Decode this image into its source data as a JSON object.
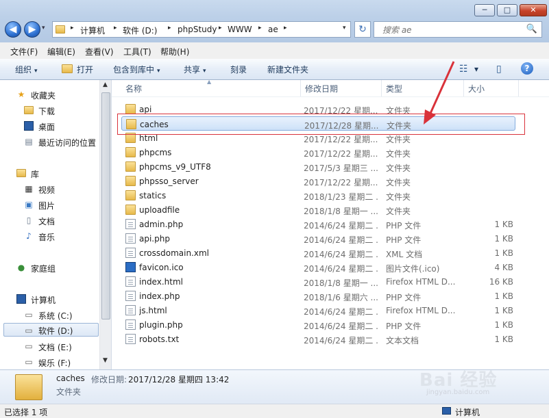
{
  "window": {
    "minimize": "─",
    "maximize": "□",
    "close": "✕"
  },
  "nav": {
    "back": "◀",
    "forward": "▶",
    "dropdown": "▾"
  },
  "address": {
    "crumbs": [
      "计算机",
      "软件 (D:)",
      "phpStudy",
      "WWW",
      "ae"
    ],
    "separator": "▸",
    "dropdown": "▾",
    "refresh": "↻"
  },
  "search": {
    "placeholder": "搜索 ae",
    "icon": "🔍"
  },
  "menu": [
    "文件(F)",
    "编辑(E)",
    "查看(V)",
    "工具(T)",
    "帮助(H)"
  ],
  "commands": {
    "organize": "组织",
    "open": "打开",
    "include": "包含到库中",
    "share": "共享",
    "burn": "刻录",
    "new_folder": "新建文件夹",
    "caret": "▾",
    "view_icon": "☷",
    "pane_icon": "▯",
    "help": "?"
  },
  "navpane": {
    "favorites": {
      "label": "收藏夹",
      "items": [
        "下载",
        "桌面",
        "最近访问的位置"
      ]
    },
    "libraries": {
      "label": "库",
      "items": [
        "视频",
        "图片",
        "文档",
        "音乐"
      ]
    },
    "homegroup": "家庭组",
    "computer": {
      "label": "计算机",
      "items": [
        "系统 (C:)",
        "软件 (D:)",
        "文档 (E:)",
        "娱乐 (F:)"
      ]
    },
    "scroll_up": "▲",
    "scroll_down": "▼"
  },
  "columns": {
    "name": "名称",
    "date": "修改日期",
    "type": "类型",
    "size": "大小",
    "sort_arrow": "▲"
  },
  "files": [
    {
      "name": "api",
      "date": "2017/12/22 星期...",
      "type": "文件夹",
      "size": "",
      "kind": "folder"
    },
    {
      "name": "caches",
      "date": "2017/12/28 星期...",
      "type": "文件夹",
      "size": "",
      "kind": "folder"
    },
    {
      "name": "html",
      "date": "2017/12/22 星期...",
      "type": "文件夹",
      "size": "",
      "kind": "folder"
    },
    {
      "name": "phpcms",
      "date": "2017/12/22 星期...",
      "type": "文件夹",
      "size": "",
      "kind": "folder"
    },
    {
      "name": "phpcms_v9_UTF8",
      "date": "2017/5/3 星期三 ...",
      "type": "文件夹",
      "size": "",
      "kind": "folder"
    },
    {
      "name": "phpsso_server",
      "date": "2017/12/22 星期...",
      "type": "文件夹",
      "size": "",
      "kind": "folder"
    },
    {
      "name": "statics",
      "date": "2018/1/23 星期二 ...",
      "type": "文件夹",
      "size": "",
      "kind": "folder"
    },
    {
      "name": "uploadfile",
      "date": "2018/1/8 星期一 ...",
      "type": "文件夹",
      "size": "",
      "kind": "folder"
    },
    {
      "name": "admin.php",
      "date": "2014/6/24 星期二 ...",
      "type": "PHP 文件",
      "size": "1 KB",
      "kind": "doc"
    },
    {
      "name": "api.php",
      "date": "2014/6/24 星期二 ...",
      "type": "PHP 文件",
      "size": "1 KB",
      "kind": "doc"
    },
    {
      "name": "crossdomain.xml",
      "date": "2014/6/24 星期二 ...",
      "type": "XML 文档",
      "size": "1 KB",
      "kind": "doc"
    },
    {
      "name": "favicon.ico",
      "date": "2014/6/24 星期二 ...",
      "type": "图片文件(.ico)",
      "size": "4 KB",
      "kind": "ico"
    },
    {
      "name": "index.html",
      "date": "2018/1/8 星期一 ...",
      "type": "Firefox HTML D...",
      "size": "16 KB",
      "kind": "doc"
    },
    {
      "name": "index.php",
      "date": "2018/1/6 星期六 ...",
      "type": "PHP 文件",
      "size": "1 KB",
      "kind": "doc"
    },
    {
      "name": "js.html",
      "date": "2014/6/24 星期二 ...",
      "type": "Firefox HTML D...",
      "size": "1 KB",
      "kind": "doc"
    },
    {
      "name": "plugin.php",
      "date": "2014/6/24 星期二 ...",
      "type": "PHP 文件",
      "size": "1 KB",
      "kind": "doc"
    },
    {
      "name": "robots.txt",
      "date": "2014/6/24 星期二 ...",
      "type": "文本文档",
      "size": "1 KB",
      "kind": "doc"
    }
  ],
  "selected_index": 1,
  "details": {
    "name": "caches",
    "modified_label": "修改日期:",
    "modified_value": "2017/12/28 星期四 13:42",
    "type": "文件夹"
  },
  "status": {
    "selection": "已选择 1 项",
    "computer": "计算机"
  },
  "watermark": {
    "logo": "Bai 经验",
    "url": "jingyan.baidu.com"
  },
  "colors": {
    "accent": "#3b6fb5",
    "highlight_box": "#d9323a",
    "arrow": "#d9323a"
  }
}
